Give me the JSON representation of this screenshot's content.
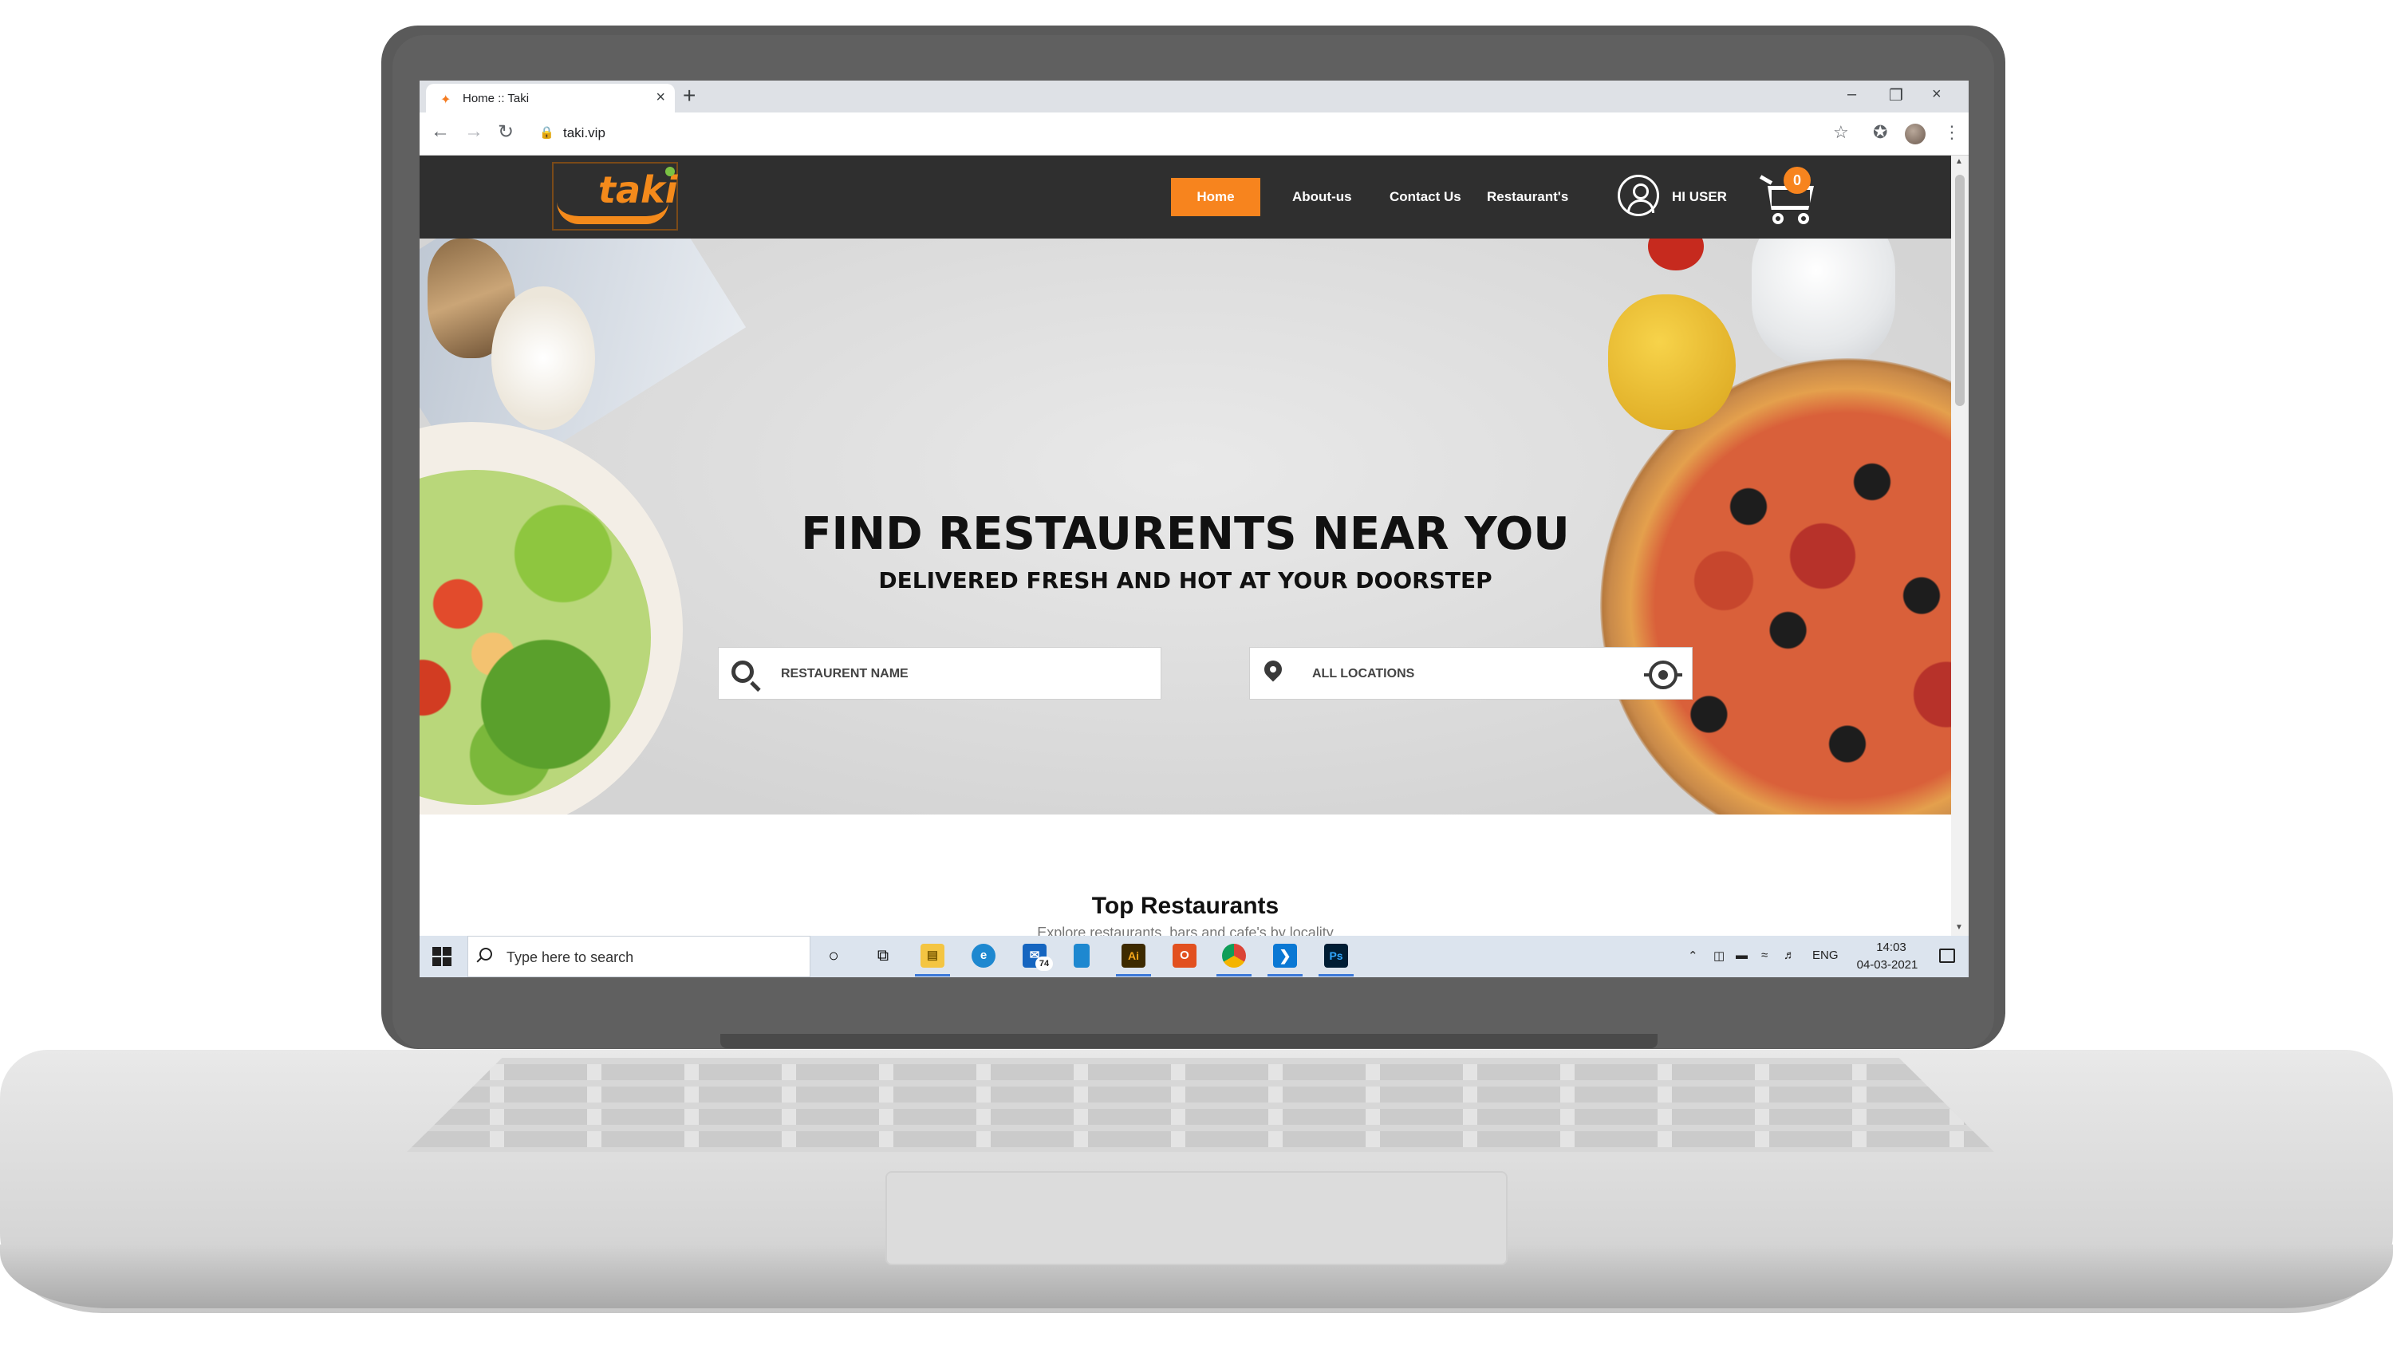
{
  "browser": {
    "tab_title": "Home :: Taki",
    "url": "taki.vip"
  },
  "site": {
    "logo_text": "taki",
    "nav": {
      "home": "Home",
      "about": "About-us",
      "contact": "Contact Us",
      "restaurants": "Restaurant's"
    },
    "user_label": "HI USER",
    "cart_count": "0",
    "accent_color": "#f7841e"
  },
  "hero": {
    "title": "FIND RESTAURENTS NEAR YOU",
    "subtitle": "DELIVERED FRESH AND HOT AT YOUR DOORSTEP",
    "search_placeholder": "RESTAURENT NAME",
    "location_placeholder": "ALL LOCATIONS"
  },
  "section": {
    "title": "Top Restaurants",
    "subtitle": "Explore restaurants, bars and cafe's by locality"
  },
  "taskbar": {
    "search_placeholder": "Type here to search",
    "mail_badge": "74",
    "language": "ENG",
    "time": "14:03",
    "date": "04-03-2021"
  }
}
